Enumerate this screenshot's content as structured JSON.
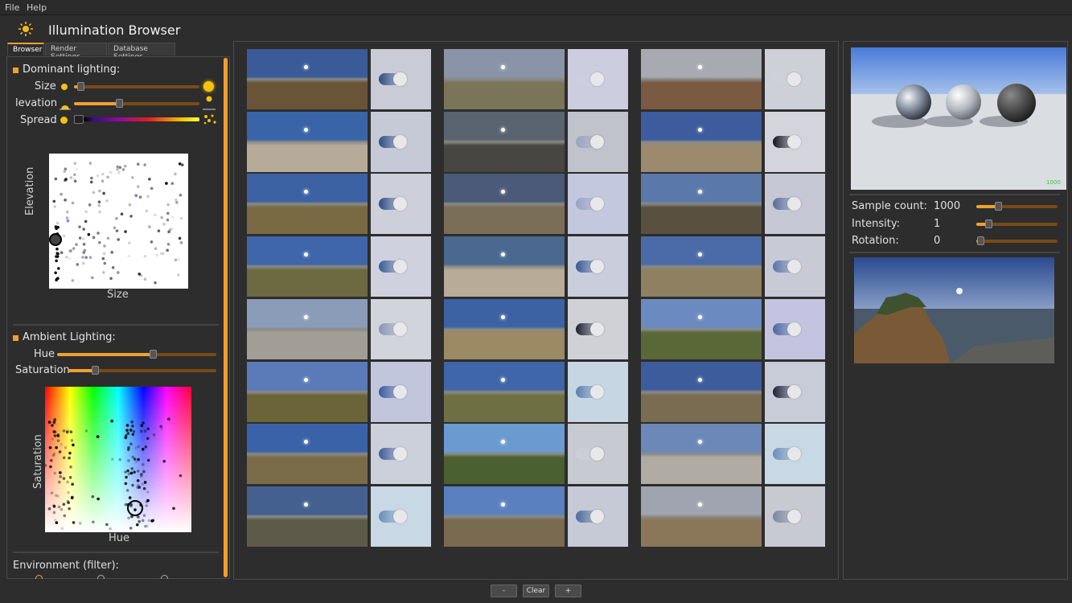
{
  "menu": {
    "file": "File",
    "help": "Help"
  },
  "header": {
    "title": "Illumination Browser"
  },
  "tabs": [
    {
      "label": "Browser",
      "active": true
    },
    {
      "label": "Render Settings",
      "active": false
    },
    {
      "label": "Database Settings",
      "active": false
    }
  ],
  "dominant": {
    "title": "Dominant lighting:",
    "size_label": "Size",
    "elevation_label": "levation",
    "spread_label": "Spread",
    "size_value": 0.05,
    "elevation_value": 0.36
  },
  "scatter": {
    "x_label": "Size",
    "y_label": "Elevation"
  },
  "ambient": {
    "title": "Ambient Lighting:",
    "hue_label": "Hue",
    "saturation_label": "Saturation",
    "hue_value": 0.6,
    "saturation_value": 0.18
  },
  "hue_plot": {
    "x_label": "Hue",
    "y_label": "Saturation"
  },
  "environment": {
    "title": "Environment (filter):"
  },
  "render": {
    "badge": "1000"
  },
  "settings": {
    "sample_count_label": "Sample count:",
    "sample_count_value": "1000",
    "intensity_label": "Intensity:",
    "intensity_value": "1",
    "rotation_label": "Rotation:",
    "rotation_value": "0",
    "sample_count_level": 0.27,
    "intensity_level": 0.15,
    "rotation_level": 0.05
  },
  "buttons": {
    "minus": "-",
    "clear": "Clear",
    "plus": "+"
  },
  "thumbnails": [
    {
      "sky": "#3a5a98",
      "ground": "#6a5438",
      "preview": "#c9ccd6",
      "pill": "#2e4a80"
    },
    {
      "sky": "#3a64a8",
      "ground": "#b6aa98",
      "preview": "#c6cad6",
      "pill": "#2e4c86"
    },
    {
      "sky": "#3c62a4",
      "ground": "#7a6a44",
      "preview": "#cdd0da",
      "pill": "#2e4c86"
    },
    {
      "sky": "#3e66a8",
      "ground": "#6c6a40",
      "preview": "#cfd2de",
      "pill": "#3a5a94"
    },
    {
      "sky": "#8a9cb8",
      "ground": "#a29e96",
      "preview": "#d2d4dc",
      "pill": "#8a94b8"
    },
    {
      "sky": "#5a7ab8",
      "ground": "#6a6438",
      "preview": "#c2c6dc",
      "pill": "#3a5aa2"
    },
    {
      "sky": "#3a62a8",
      "ground": "#7a6c48",
      "preview": "#ccd0da",
      "pill": "#3c5c9a"
    },
    {
      "sky": "#44608e",
      "ground": "#5e5a4a",
      "preview": "#c8d8e4",
      "pill": "#6a8cb8"
    },
    {
      "sky": "#8a94a8",
      "ground": "#7a7458",
      "preview": "#cccee0",
      "pill": "#ccd0e0"
    },
    {
      "sky": "#5a6470",
      "ground": "#484640",
      "preview": "#c0c2cc",
      "pill": "#9aa4c0"
    },
    {
      "sky": "#4a5a78",
      "ground": "#7a6e56",
      "preview": "#c4c8de",
      "pill": "#9aa2c8"
    },
    {
      "sky": "#4a6890",
      "ground": "#b8ac98",
      "preview": "#cacedc",
      "pill": "#3a5894"
    },
    {
      "sky": "#3c62a4",
      "ground": "#9c8a64",
      "preview": "#cfd1d6",
      "pill": "#1c2030"
    },
    {
      "sky": "#3e66a8",
      "ground": "#6e7044",
      "preview": "#c6d6e2",
      "pill": "#5a80b0"
    },
    {
      "sky": "#6a9ad0",
      "ground": "#4a6030",
      "preview": "#c8cad2",
      "pill": "#ced0d8"
    },
    {
      "sky": "#5a80c0",
      "ground": "#7a6a50",
      "preview": "#c6cad6",
      "pill": "#4a6a9c"
    },
    {
      "sky": "#a8aab2",
      "ground": "#7a5a40",
      "preview": "#ced0d8",
      "pill": "#cfd1d8"
    },
    {
      "sky": "#3c5c9e",
      "ground": "#9c8a6c",
      "preview": "#d4d4dc",
      "pill": "#10141c"
    },
    {
      "sky": "#5a78aa",
      "ground": "#5a5040",
      "preview": "#c6c8d6",
      "pill": "#5a6e98"
    },
    {
      "sky": "#4a6aa8",
      "ground": "#8e8060",
      "preview": "#c8cad6",
      "pill": "#5a74a8"
    },
    {
      "sky": "#6a8ac0",
      "ground": "#5a6838",
      "preview": "#c4c4e0",
      "pill": "#4a68a0"
    },
    {
      "sky": "#3c5c9c",
      "ground": "#7a6c50",
      "preview": "#c8ccd8",
      "pill": "#1a2038"
    },
    {
      "sky": "#6c88b8",
      "ground": "#b0aca4",
      "preview": "#c8d8e4",
      "pill": "#6a8cb8"
    },
    {
      "sky": "#a0a4b0",
      "ground": "#8a7658",
      "preview": "#c8cad2",
      "pill": "#7a86a0"
    }
  ]
}
